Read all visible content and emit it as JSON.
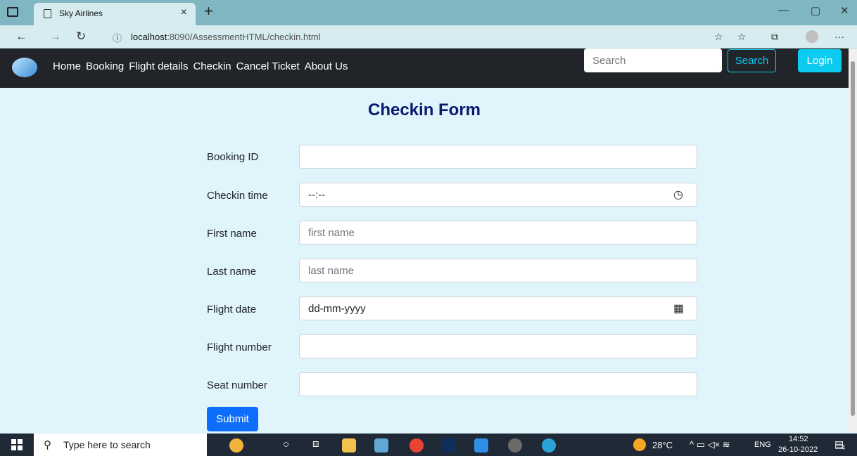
{
  "browser": {
    "tab_title": "Sky Airlines",
    "tab_close": "×",
    "new_tab": "+",
    "url_host": "localhost",
    "url_path": ":8090/AssessmentHTML/checkin.html"
  },
  "navbar": {
    "links": [
      "Home",
      "Booking",
      "Flight details",
      "Checkin",
      "Cancel Ticket",
      "About Us"
    ],
    "search_placeholder": "Search",
    "search_button": "Search",
    "login_button": "Login"
  },
  "form": {
    "title": "Checkin Form",
    "fields": [
      {
        "label": "Booking ID",
        "placeholder": "",
        "value": ""
      },
      {
        "label": "Checkin time",
        "placeholder": "",
        "value": "--:--"
      },
      {
        "label": "First name",
        "placeholder": "first name",
        "value": ""
      },
      {
        "label": "Last name",
        "placeholder": "last name",
        "value": ""
      },
      {
        "label": "Flight date",
        "placeholder": "",
        "value": "dd-mm-yyyy"
      },
      {
        "label": "Flight number",
        "placeholder": "",
        "value": ""
      },
      {
        "label": "Seat number",
        "placeholder": "",
        "value": ""
      }
    ],
    "submit": "Submit"
  },
  "taskbar": {
    "search_placeholder": "Type here to search",
    "temperature": "28°C",
    "language": "ENG",
    "time": "14:52",
    "date": "26-10-2022",
    "notification_count": "4"
  },
  "colors": {
    "page_bg": "#dff4fb",
    "navbar_bg": "#212529",
    "title": "#0b1a6e",
    "accent_cyan": "#0dcaf0",
    "submit_blue": "#0d6efd"
  }
}
